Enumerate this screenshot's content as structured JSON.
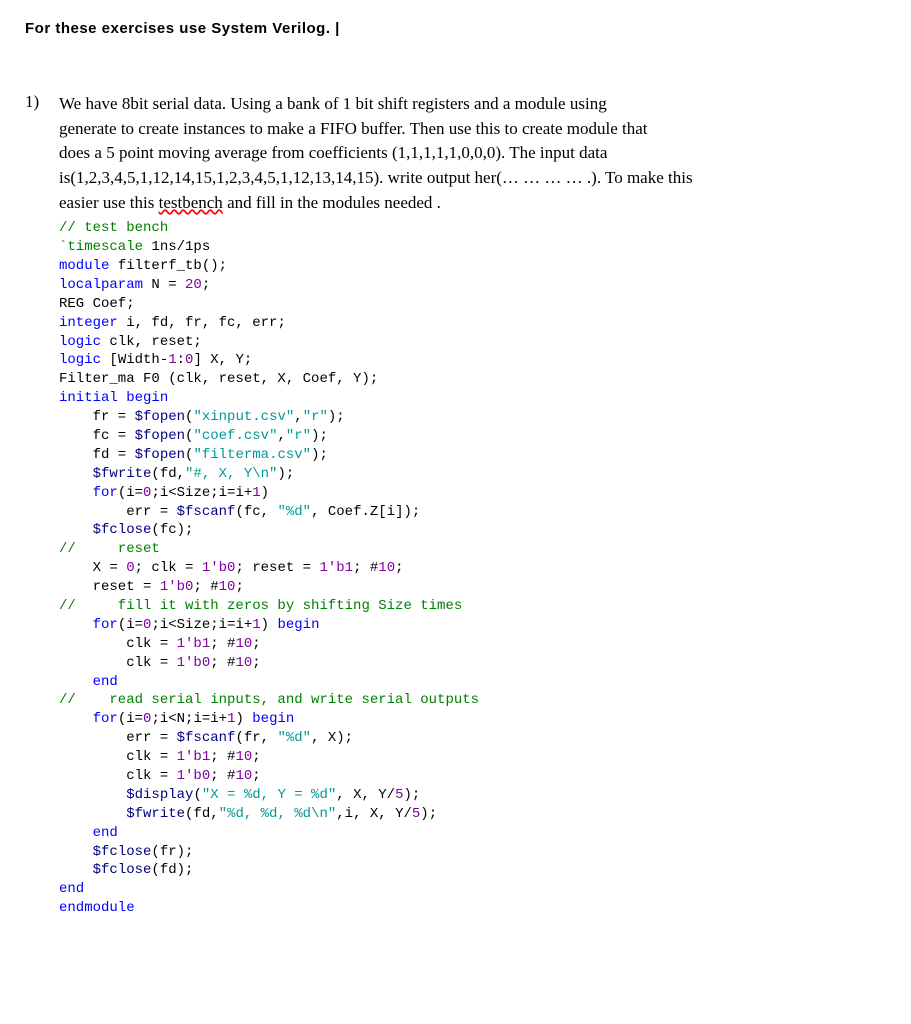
{
  "header": "For these exercises use System Verilog. |",
  "qnum": "1)",
  "prose": [
    "We have 8bit serial data. Using a bank of 1 bit shift registers and a module using",
    "generate to create instances to make a FIFO buffer. Then use this to create module that",
    "does a 5 point moving average from coefficients (1,1,1,1,1,0,0,0). The input data",
    "is(1,2,3,4,5,1,12,14,15,1,2,3,4,5,1,12,13,14,15). write output her(… … … … .). To make this",
    "easier use this ",
    " and fill in the modules needed ."
  ],
  "squiggle": "testbench",
  "code": {
    "l01a": "// test bench",
    "l02a": "`timescale",
    "l02b": " 1ns/1ps",
    "l03a": "module ",
    "l03b": "filterf_tb",
    "l03c": "();",
    "l04a": "localparam ",
    "l04b": "N = ",
    "l04c": "20",
    "l04d": ";",
    "l05a": "REG Coef;",
    "l06a": "integer ",
    "l06b": "i, fd, fr, fc, err;",
    "l07a": "logic ",
    "l07b": "clk, reset;",
    "l08a": "logic ",
    "l08b": "[Width-",
    "l08c": "1",
    "l08d": ":",
    "l08e": "0",
    "l08f": "] X, Y;",
    "l09a": "Filter_ma F0 (clk, reset, X, Coef, Y);",
    "l10a": "initial begin",
    "l11a": "    fr = ",
    "l11b": "$fopen",
    "l11c": "(",
    "l11d": "\"xinput.csv\"",
    "l11e": ",",
    "l11f": "\"r\"",
    "l11g": ");",
    "l12a": "    fc = ",
    "l12b": "$fopen",
    "l12c": "(",
    "l12d": "\"coef.csv\"",
    "l12e": ",",
    "l12f": "\"r\"",
    "l12g": ");",
    "l13a": "    fd = ",
    "l13b": "$fopen",
    "l13c": "(",
    "l13d": "\"filterma.csv\"",
    "l13e": ");",
    "l14a": "    ",
    "l14b": "$fwrite",
    "l14c": "(fd,",
    "l14d": "\"#, X, Y\\n\"",
    "l14e": ");",
    "l15a": "    for",
    "l15b": "(i=",
    "l15c": "0",
    "l15d": ";i<Size;i=i+",
    "l15e": "1",
    "l15f": ")",
    "l16a": "        err = ",
    "l16b": "$fscanf",
    "l16c": "(fc, ",
    "l16d": "\"%d\"",
    "l16e": ", Coef.Z[i]);",
    "l17a": "    ",
    "l17b": "$fclose",
    "l17c": "(fc);",
    "l18a": "//     reset",
    "l19a": "    X = ",
    "l19b": "0",
    "l19c": "; clk = ",
    "l19d": "1'b0",
    "l19e": "; reset = ",
    "l19f": "1'b1",
    "l19g": "; #",
    "l19h": "10",
    "l19i": ";",
    "l20a": "    reset = ",
    "l20b": "1'b0",
    "l20c": "; #",
    "l20d": "10",
    "l20e": ";",
    "l21a": "//     fill it with zeros by shifting Size times",
    "l22a": "    for",
    "l22b": "(i=",
    "l22c": "0",
    "l22d": ";i<Size;i=i+",
    "l22e": "1",
    "l22f": ") ",
    "l22g": "begin",
    "l23a": "        clk = ",
    "l23b": "1'b1",
    "l23c": "; #",
    "l23d": "10",
    "l23e": ";",
    "l24a": "        clk = ",
    "l24b": "1'b0",
    "l24c": "; #",
    "l24d": "10",
    "l24e": ";",
    "l25a": "    end",
    "l26a": "//    read serial inputs, and write serial outputs",
    "l27a": "    for",
    "l27b": "(i=",
    "l27c": "0",
    "l27d": ";i<N;i=i+",
    "l27e": "1",
    "l27f": ") ",
    "l27g": "begin",
    "l28a": "        err = ",
    "l28b": "$fscanf",
    "l28c": "(fr, ",
    "l28d": "\"%d\"",
    "l28e": ", X);",
    "l29a": "        clk = ",
    "l29b": "1'b1",
    "l29c": "; #",
    "l29d": "10",
    "l29e": ";",
    "l30a": "        clk = ",
    "l30b": "1'b0",
    "l30c": "; #",
    "l30d": "10",
    "l30e": ";",
    "l31a": "        ",
    "l31b": "$display",
    "l31c": "(",
    "l31d": "\"X = %d, Y = %d\"",
    "l31e": ", X, Y/",
    "l31f": "5",
    "l31g": ");",
    "l32a": "        ",
    "l32b": "$fwrite",
    "l32c": "(fd,",
    "l32d": "\"%d, %d, %d\\n\"",
    "l32e": ",i, X, Y/",
    "l32f": "5",
    "l32g": ");",
    "l33a": "    end",
    "l34a": "    ",
    "l34b": "$fclose",
    "l34c": "(fr);",
    "l35a": "    ",
    "l35b": "$fclose",
    "l35c": "(fd);",
    "l36a": "end",
    "l37a": "endmodule"
  }
}
